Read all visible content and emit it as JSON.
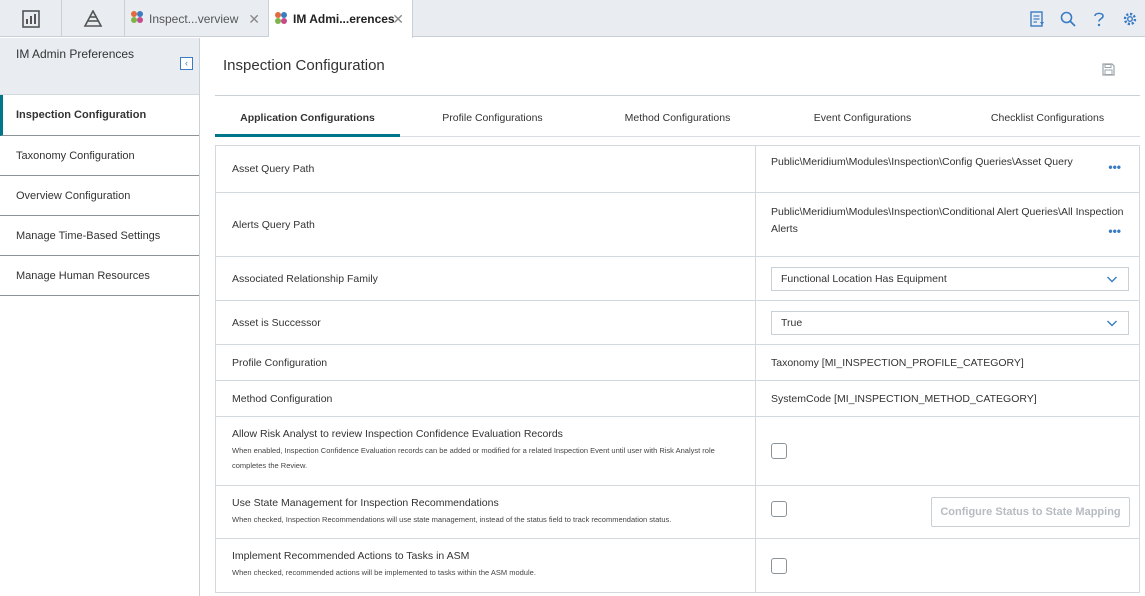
{
  "tabs": [
    {
      "label": "Inspect...verview"
    },
    {
      "label": "IM Admi...erences"
    }
  ],
  "sidebar": {
    "title": "IM Admin Preferences",
    "items": [
      {
        "label": "Inspection Configuration"
      },
      {
        "label": "Taxonomy Configuration"
      },
      {
        "label": "Overview Configuration"
      },
      {
        "label": "Manage Time-Based Settings"
      },
      {
        "label": "Manage Human Resources"
      }
    ]
  },
  "main": {
    "title": "Inspection Configuration",
    "config_tabs": [
      {
        "label": "Application Configurations"
      },
      {
        "label": "Profile Configurations"
      },
      {
        "label": "Method Configurations"
      },
      {
        "label": "Event Configurations"
      },
      {
        "label": "Checklist Configurations"
      }
    ],
    "rows": {
      "asset_query": {
        "label": "Asset Query Path",
        "value": "Public\\Meridium\\Modules\\Inspection\\Config Queries\\Asset Query",
        "more": "•••"
      },
      "alerts_query": {
        "label": "Alerts Query Path",
        "value_line1": "Public\\Meridium\\Modules\\Inspection\\Conditional Alert Queries\\All Inspection",
        "value_line2": "Alerts",
        "more": "•••"
      },
      "relationship": {
        "label": "Associated Relationship Family",
        "value": "Functional Location Has Equipment"
      },
      "successor": {
        "label": "Asset is Successor",
        "value": "True"
      },
      "profile": {
        "label": "Profile Configuration",
        "value": "Taxonomy [MI_INSPECTION_PROFILE_CATEGORY]"
      },
      "method": {
        "label": "Method Configuration",
        "value": "SystemCode [MI_INSPECTION_METHOD_CATEGORY]"
      },
      "risk_analyst": {
        "label": "Allow Risk Analyst to review Inspection Confidence Evaluation Records",
        "desc_line1": "When enabled, Inspection Confidence Evaluation records can be added or modified for a related Inspection Event until user with Risk Analyst role",
        "desc_line2": "completes the Review."
      },
      "state_mgmt": {
        "label": "Use State Management for Inspection Recommendations",
        "desc": "When checked, Inspection Recommendations will use state management, instead of the status field to track recommendation status.",
        "button": "Configure Status to State Mapping"
      },
      "asm": {
        "label": "Implement Recommended Actions to Tasks in ASM",
        "desc": "When checked, recommended actions will be implemented to tasks within the ASM module."
      }
    }
  },
  "icons": {
    "dashboard": "dashboard-icon",
    "hierarchy": "asset-hierarchy-icon",
    "tasks": "task-list-icon",
    "search": "search-icon",
    "help": "help-icon",
    "settings": "gear-icon",
    "save": "save-icon"
  },
  "colors": {
    "accent": "#00768b",
    "link": "#3a7cc3"
  }
}
